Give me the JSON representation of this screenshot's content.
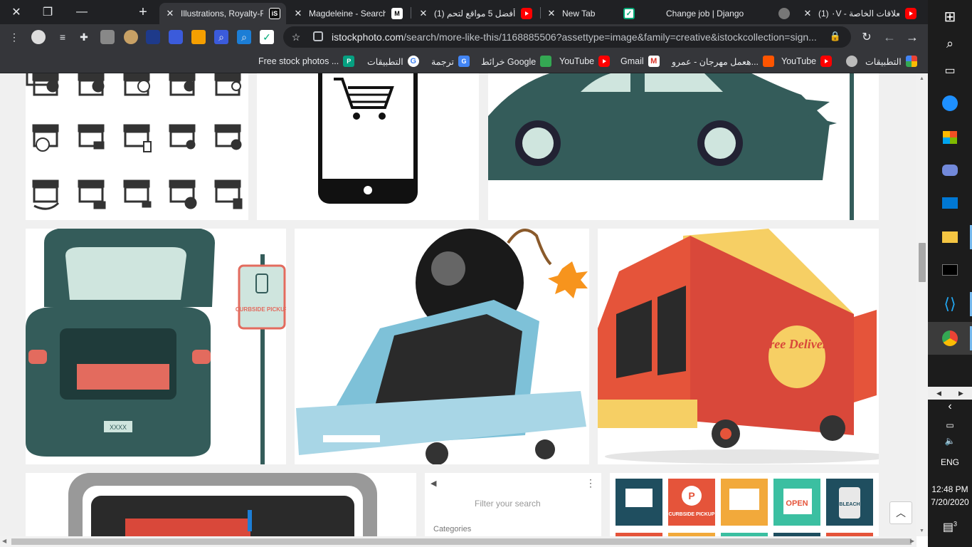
{
  "tabs": [
    {
      "title": "Illustrations, Royalty-Fr",
      "favicon": "iS",
      "active": true
    },
    {
      "title": "Magdeleine - Search",
      "favicon": "M"
    },
    {
      "title": "(1) أفضل 5 مواقع لتحم",
      "favicon": "youtube"
    },
    {
      "title": "New Tab",
      "favicon": ""
    },
    {
      "title": "Change job | Django",
      "favicon": "checkbox"
    },
    {
      "title": "(1) ٠V - العلاقات الخاصة",
      "favicon": "youtube"
    }
  ],
  "window_controls": {
    "close": "✕",
    "restore": "❐",
    "minimize": "—",
    "new_tab": "+"
  },
  "address": {
    "host": "istockphoto.com",
    "path": "/search/more-like-this/1168885506?assettype=image&family=creative&istockcollection=sign..."
  },
  "bookmarks": [
    {
      "label": "التطبيقات",
      "icon": "apps-grid-icon"
    },
    {
      "label": "YouTube",
      "icon": "globe-icon"
    },
    {
      "label": "هعمل مهرجان - عمرو...",
      "icon": "youtube-icon"
    },
    {
      "label": "Gmail",
      "icon": "soundcloud-icon"
    },
    {
      "label": "YouTube",
      "icon": "gmail-icon"
    },
    {
      "label": "خرائط Google",
      "icon": "youtube-icon"
    },
    {
      "label": "ترجمة",
      "icon": "maps-icon"
    },
    {
      "label": "التطبيقات",
      "icon": "translate-icon"
    },
    {
      "label": "Free stock photos ...",
      "icon": "google-icon"
    }
  ],
  "page": {
    "filter_placeholder": "Filter your search",
    "categories_label": "Categories",
    "curbside_sign": "CURBSIDE PICKUP",
    "free_delivery": "Free Delivery",
    "plate": "XXXX",
    "open_sign": "OPEN",
    "bleach": "BLEACH",
    "curbside_small": "CURBSIDE PICKUP"
  },
  "taskbar": {
    "language": "ENG",
    "time": "12:48 PM",
    "date": "7/20/2020",
    "notifications": "3"
  },
  "colors": {
    "tab_bg": "#202124",
    "toolbar": "#35363a",
    "accent": "#1a73e8"
  }
}
